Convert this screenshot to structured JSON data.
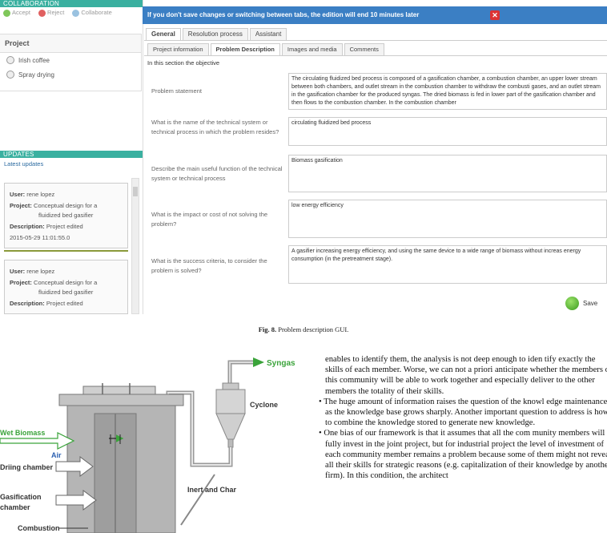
{
  "collaboration": {
    "header": "COLLABORATION",
    "actions": [
      "Accept",
      "Reject",
      "Collaborate"
    ]
  },
  "project_panel": {
    "title": "Project",
    "items": [
      "Irish coffee",
      "Spray drying"
    ]
  },
  "updates": {
    "header": "UPDATES",
    "latest": "Latest updates",
    "cards": [
      {
        "user_label": "User:",
        "user": "rene lopez",
        "project_label": "Project:",
        "project_line1": "Conceptual design for a",
        "project_line2": "fluidized bed gasifier",
        "description_label": "Description:",
        "description": "Project edited",
        "timestamp": "2015-05-29 11:01:55.0"
      },
      {
        "user_label": "User:",
        "user": "rene lopez",
        "project_label": "Project:",
        "project_line1": "Conceptual design for a",
        "project_line2": "fluidized bed gasifier",
        "description_label": "Description:",
        "description": "Project edited",
        "timestamp": ""
      }
    ]
  },
  "warning": "If you don't save changes or switching between tabs, the edition will end 10 minutes later",
  "tabs_main": [
    "General",
    "Resolution process",
    "Assistant"
  ],
  "tabs_sub": [
    "Project information",
    "Problem Description",
    "Images and media",
    "Comments"
  ],
  "intro": "In this section the objective",
  "questions": [
    {
      "label": "Problem statement",
      "answer": "The circulating fluidized bed process is composed of a gasification chamber, a combustion chamber, an upper lower stream between both chambers, and outlet stream in the combustion chamber to withdraw the combusti gases, and an outlet stream in the gasification chamber for the produced syngas. The dried biomass is fed in lower part of the gasification chamber and then flows to the combustion chamber. In the combustion chamber"
    },
    {
      "label": "What is the name of the technical system or technical process in which the problem resides?",
      "answer": "circulating fluidized bed process"
    },
    {
      "label": "Describe the main useful function of the technical system or technical process",
      "answer": "Biomass gasification"
    },
    {
      "label": "What is the impact or cost of not solving the problem?",
      "answer": "low energy efficiency"
    },
    {
      "label": "What is the success criteria, to consider the problem is solved?",
      "answer": "A gasifier  increasing energy efficiency, and using the same device to a wide range of biomass without increas energy consumption (in the pretreatment stage)."
    }
  ],
  "save_label": "Save",
  "caption": {
    "fig": "Fig. 8.",
    "text": "Problem description GUI."
  },
  "diagram": {
    "labels": {
      "syngas": "Syngas",
      "cyclone": "Cyclone",
      "wet_biomass": "Wet Biomass",
      "air": "Air",
      "drying": "Driing chamber",
      "gasification_1": "Gasification",
      "gasification_2": "chamber",
      "inert": "Inert and Char",
      "combustion": "Combustion"
    },
    "colors": {
      "arrow_green": "#3aa33a",
      "vessel": "#b5b5b5",
      "vessel_dark": "#8d8d8d",
      "label_blue": "#2a5fb0"
    }
  },
  "body": [
    {
      "type": "cont",
      "text": "enables to identify them, the analysis is not deep enough to iden tify exactly the skills of each member. Worse, we can not a priori anticipate whether the members of this community will be able to work together and especially deliver to the other members the totality of their skills."
    },
    {
      "type": "bullet",
      "text": "The huge amount of information raises the question of the knowl edge maintenance as the knowledge base grows sharply. Another important question to address is how to combine the knowledge stored to generate new knowledge."
    },
    {
      "type": "bullet",
      "text": "One bias of our framework is that it assumes that all the com munity members will fully invest in the joint project, but for industrial project the level of investment of each community member remains a problem because some of them might not reveal all their skills for strategic reasons (e.g. capitalization of their knowledge by another firm). In this condition, the architect"
    }
  ]
}
